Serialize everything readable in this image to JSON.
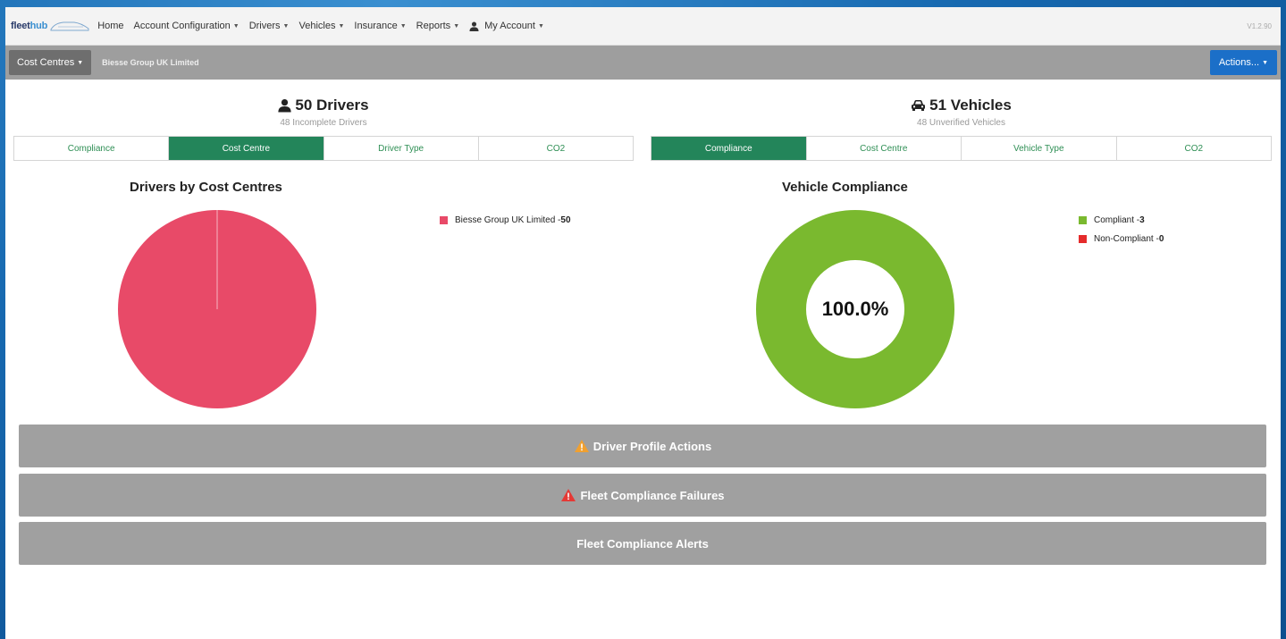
{
  "nav": {
    "logo": {
      "part1": "fleet",
      "part2": "hub"
    },
    "items": [
      {
        "label": "Home",
        "caret": false
      },
      {
        "label": "Account Configuration",
        "caret": true
      },
      {
        "label": "Drivers",
        "caret": true
      },
      {
        "label": "Vehicles",
        "caret": true
      },
      {
        "label": "Insurance",
        "caret": true
      },
      {
        "label": "Reports",
        "caret": true
      },
      {
        "label": "My Account",
        "caret": true
      }
    ],
    "version": "V1.2.90"
  },
  "subbar": {
    "cost_centres_label": "Cost Centres",
    "breadcrumb": "Biesse Group UK Limited",
    "actions_label": "Actions..."
  },
  "drivers": {
    "headline": "50 Drivers",
    "subhead": "48 Incomplete Drivers",
    "tabs": [
      "Compliance",
      "Cost Centre",
      "Driver Type",
      "CO2"
    ],
    "active_tab": 1,
    "chart_title": "Drivers by Cost Centres",
    "legend": [
      {
        "label": "Biesse Group UK Limited - ",
        "value": "50",
        "color": "#e84a68"
      }
    ]
  },
  "vehicles": {
    "headline": "51 Vehicles",
    "subhead": "48 Unverified Vehicles",
    "tabs": [
      "Compliance",
      "Cost Centre",
      "Vehicle Type",
      "CO2"
    ],
    "active_tab": 0,
    "chart_title": "Vehicle Compliance",
    "center_label": "100.0%",
    "legend": [
      {
        "label": "Compliant - ",
        "value": "3",
        "color": "#7ab92f"
      },
      {
        "label": "Non-Compliant - ",
        "value": "0",
        "color": "#e52b2b"
      }
    ]
  },
  "bars": [
    {
      "label": "Driver Profile Actions",
      "icon": "warning-icon",
      "icon_color": "#f0a030"
    },
    {
      "label": "Fleet Compliance Failures",
      "icon": "alert-icon",
      "icon_color": "#e53935"
    },
    {
      "label": "Fleet Compliance Alerts",
      "icon": "",
      "icon_color": ""
    }
  ],
  "chart_data": [
    {
      "type": "pie",
      "title": "Drivers by Cost Centres",
      "categories": [
        "Biesse Group UK Limited"
      ],
      "values": [
        50
      ],
      "colors": [
        "#e84a68"
      ],
      "legend": "right"
    },
    {
      "type": "pie",
      "title": "Vehicle Compliance",
      "categories": [
        "Compliant",
        "Non-Compliant"
      ],
      "values": [
        3,
        0
      ],
      "colors": [
        "#7ab92f",
        "#e52b2b"
      ],
      "donut": true,
      "center_label": "100.0%",
      "legend": "right"
    }
  ]
}
